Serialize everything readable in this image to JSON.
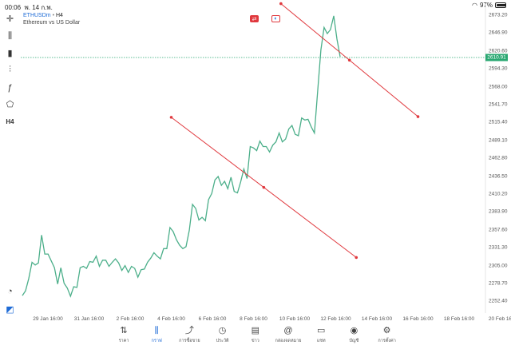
{
  "status": {
    "time": "00:06",
    "date": "พ. 14 ก.พ.",
    "battery": "97%",
    "battery_level": 0.97
  },
  "symbol": {
    "ticker": "ETHUSDm",
    "separator": "•",
    "timeframe": "H4",
    "description": "Ethereum vs US Dollar"
  },
  "left_tools": [
    {
      "icon": "crosshair-icon",
      "glyph": "✛"
    },
    {
      "icon": "candles-icon",
      "glyph": "⫼"
    },
    {
      "icon": "bar-chart-icon",
      "glyph": "▮"
    },
    {
      "icon": "indicators-icon",
      "glyph": "⫶"
    },
    {
      "icon": "function-icon",
      "glyph": "ƒ"
    },
    {
      "icon": "shapes-icon",
      "glyph": "⬠"
    },
    {
      "icon": "timeframe-label",
      "glyph": "H4"
    }
  ],
  "price_axis": [
    "2673.20",
    "2646.90",
    "2620.60",
    "2594.30",
    "2568.00",
    "2541.70",
    "2515.40",
    "2489.10",
    "2462.80",
    "2436.50",
    "2410.20",
    "2383.90",
    "2357.60",
    "2331.30",
    "2305.00",
    "2278.70",
    "2252.40"
  ],
  "current_price": "2610.91",
  "time_axis": [
    "29 Jan 16:00",
    "31 Jan 16:00",
    "2 Feb 16:00",
    "4 Feb 16:00",
    "6 Feb 16:00",
    "8 Feb 16:00",
    "10 Feb 16:00",
    "12 Feb 16:00",
    "14 Feb 16:00",
    "16 Feb 16:00",
    "18 Feb 16:00",
    "20 Feb 16"
  ],
  "colors": {
    "line": "#4caf8a",
    "trend": "#e0393e",
    "current": "#2aa872",
    "accent": "#1e6bd6"
  },
  "chart_data": {
    "type": "line",
    "title": "ETHUSDm • H4",
    "series": [
      {
        "values": [
          2261,
          2268,
          2286,
          2310,
          2306,
          2309,
          2350,
          2322,
          2322,
          2312,
          2302,
          2278,
          2302,
          2279,
          2272,
          2260,
          2274,
          2273,
          2302,
          2304,
          2301,
          2311,
          2310,
          2319,
          2304,
          2313,
          2313,
          2304,
          2310,
          2315,
          2309,
          2298,
          2305,
          2295,
          2304,
          2301,
          2288,
          2299,
          2300,
          2310,
          2316,
          2324,
          2319,
          2315,
          2330,
          2330,
          2361,
          2355,
          2343,
          2335,
          2330,
          2333,
          2357,
          2395,
          2389,
          2372,
          2376,
          2371,
          2402,
          2411,
          2431,
          2436,
          2423,
          2429,
          2418,
          2435,
          2414,
          2412,
          2428,
          2447,
          2433,
          2480,
          2478,
          2474,
          2488,
          2480,
          2480,
          2472,
          2482,
          2487,
          2500,
          2487,
          2491,
          2506,
          2511,
          2498,
          2496,
          2522,
          2519,
          2520,
          2509,
          2500,
          2562,
          2622,
          2655,
          2646,
          2652,
          2672,
          2638,
          2612
        ]
      }
    ],
    "trendlines": [
      {
        "points": [
          [
            "4 Feb 16:00",
            2523
          ],
          [
            "13 Feb 16:00",
            2317
          ]
        ]
      },
      {
        "points": [
          [
            "10 Feb 00:00",
            2690
          ],
          [
            "16 Feb 16:00",
            2524
          ]
        ]
      }
    ],
    "ylim": [
      2240,
      2686
    ],
    "current": 2610.91,
    "grid": false
  },
  "nav": [
    {
      "label": "ราคา",
      "icon": "arrows-icon",
      "glyph": "⇅"
    },
    {
      "label": "กราฟ",
      "icon": "chart-icon",
      "glyph": "⫼",
      "active": true
    },
    {
      "label": "การซื้อขาย",
      "icon": "trade-icon",
      "glyph": "⤴"
    },
    {
      "label": "ประวัติ",
      "icon": "history-icon",
      "glyph": "◷"
    },
    {
      "label": "ข่าว",
      "icon": "news-icon",
      "glyph": "▤"
    },
    {
      "label": "กล่องจดหมาย",
      "icon": "mail-icon",
      "glyph": "@"
    },
    {
      "label": "แชท",
      "icon": "chat-icon",
      "glyph": "▭"
    },
    {
      "label": "บัญชี",
      "icon": "account-icon",
      "glyph": "◉"
    },
    {
      "label": "การตั้งค่า",
      "icon": "settings-icon",
      "glyph": "⚙"
    }
  ]
}
